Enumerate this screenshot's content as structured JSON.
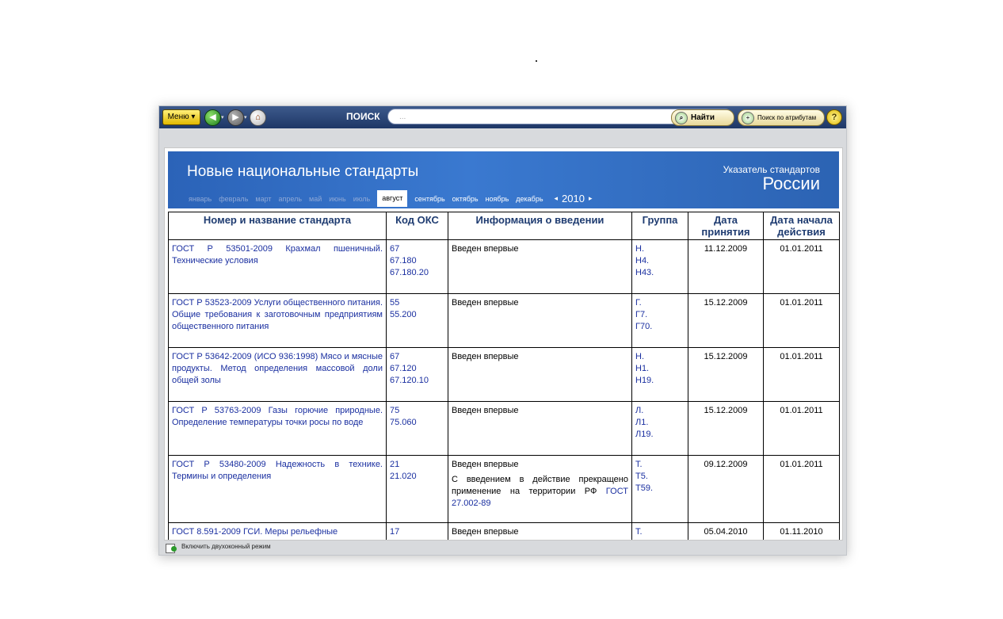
{
  "toolbar": {
    "menu_label": "Меню",
    "search_label": "ПОИСК",
    "search_placeholder": "...",
    "find_label": "Найти",
    "attr_search_label": "Поиск по атрибутам",
    "help_label": "?",
    "icons": [
      "back-arrow-icon",
      "forward-arrow-icon",
      "home-icon",
      "search-icon",
      "attribute-search-icon",
      "help-icon"
    ]
  },
  "banner": {
    "title": "Новые национальные стандарты",
    "subtitle_line1": "Указатель стандартов",
    "subtitle_line2": "России",
    "months": [
      {
        "label": "январь",
        "state": "off"
      },
      {
        "label": "февраль",
        "state": "off"
      },
      {
        "label": "март",
        "state": "off"
      },
      {
        "label": "апрель",
        "state": "off"
      },
      {
        "label": "май",
        "state": "off"
      },
      {
        "label": "июнь",
        "state": "off"
      },
      {
        "label": "июль",
        "state": "off"
      },
      {
        "label": "август",
        "state": "active"
      },
      {
        "label": "сентябрь",
        "state": "on"
      },
      {
        "label": "октябрь",
        "state": "on"
      },
      {
        "label": "ноябрь",
        "state": "on"
      },
      {
        "label": "декабрь",
        "state": "on"
      }
    ],
    "year": "2010",
    "prev_year": "◂",
    "next_year": "▸"
  },
  "table": {
    "headers": [
      "Номер и название стандарта",
      "Код ОКС",
      "Информация о введении",
      "Группа",
      "Дата принятия",
      "Дата начала действия"
    ],
    "rows": [
      {
        "name": "ГОСТ Р 53501-2009 Крахмал пшеничный. Технические условия",
        "oks": [
          "67",
          "67.180",
          "67.180.20"
        ],
        "info": "Введен впервые",
        "info_extra": "",
        "info_ref": "",
        "group": [
          "Н.",
          "Н4.",
          "Н43."
        ],
        "date_accepted": "11.12.2009",
        "date_start": "01.01.2011"
      },
      {
        "name": "ГОСТ Р 53523-2009 Услуги общественного питания. Общие требования к заготовочным предприятиям общественного питания",
        "oks": [
          "55",
          "55.200"
        ],
        "info": "Введен впервые",
        "info_extra": "",
        "info_ref": "",
        "group": [
          "Г.",
          "Г7.",
          "Г70."
        ],
        "date_accepted": "15.12.2009",
        "date_start": "01.01.2011"
      },
      {
        "name": "ГОСТ Р 53642-2009 (ИСО 936:1998) Мясо и мясные продукты. Метод определения массовой доли общей золы",
        "oks": [
          "67",
          "67.120",
          "67.120.10"
        ],
        "info": "Введен впервые",
        "info_extra": "",
        "info_ref": "",
        "group": [
          "Н.",
          "Н1.",
          "Н19."
        ],
        "date_accepted": "15.12.2009",
        "date_start": "01.01.2011"
      },
      {
        "name": "ГОСТ Р 53763-2009 Газы горючие природные. Определение температуры точки росы по воде",
        "oks": [
          "75",
          "75.060"
        ],
        "info": "Введен впервые",
        "info_extra": "",
        "info_ref": "",
        "group": [
          "Л.",
          "Л1.",
          "Л19."
        ],
        "date_accepted": "15.12.2009",
        "date_start": "01.01.2011"
      },
      {
        "name": "ГОСТ Р 53480-2009 Надежность в технике. Термины и определения",
        "oks": [
          "21",
          "21.020"
        ],
        "info": "Введен впервые",
        "info_extra": "С введением в действие прекращено применение на территории РФ",
        "info_ref": "ГОСТ 27.002-89",
        "group": [
          "Т.",
          "Т5.",
          "Т59."
        ],
        "date_accepted": "09.12.2009",
        "date_start": "01.01.2011"
      },
      {
        "name": "ГОСТ 8.591-2009 ГСИ. Меры рельефные",
        "oks": [
          "17"
        ],
        "info": "Введен впервые",
        "info_extra": "",
        "info_ref": "",
        "group": [
          "Т."
        ],
        "date_accepted": "05.04.2010",
        "date_start": "01.11.2010"
      }
    ]
  },
  "statusbar": {
    "dual_window_label": "Включить двухоконный режим"
  },
  "colors": {
    "toolbar_bg": "#1e3766",
    "banner_bg": "#3a79d0",
    "link": "#1a2fa0",
    "header_text": "#1f3c71"
  }
}
